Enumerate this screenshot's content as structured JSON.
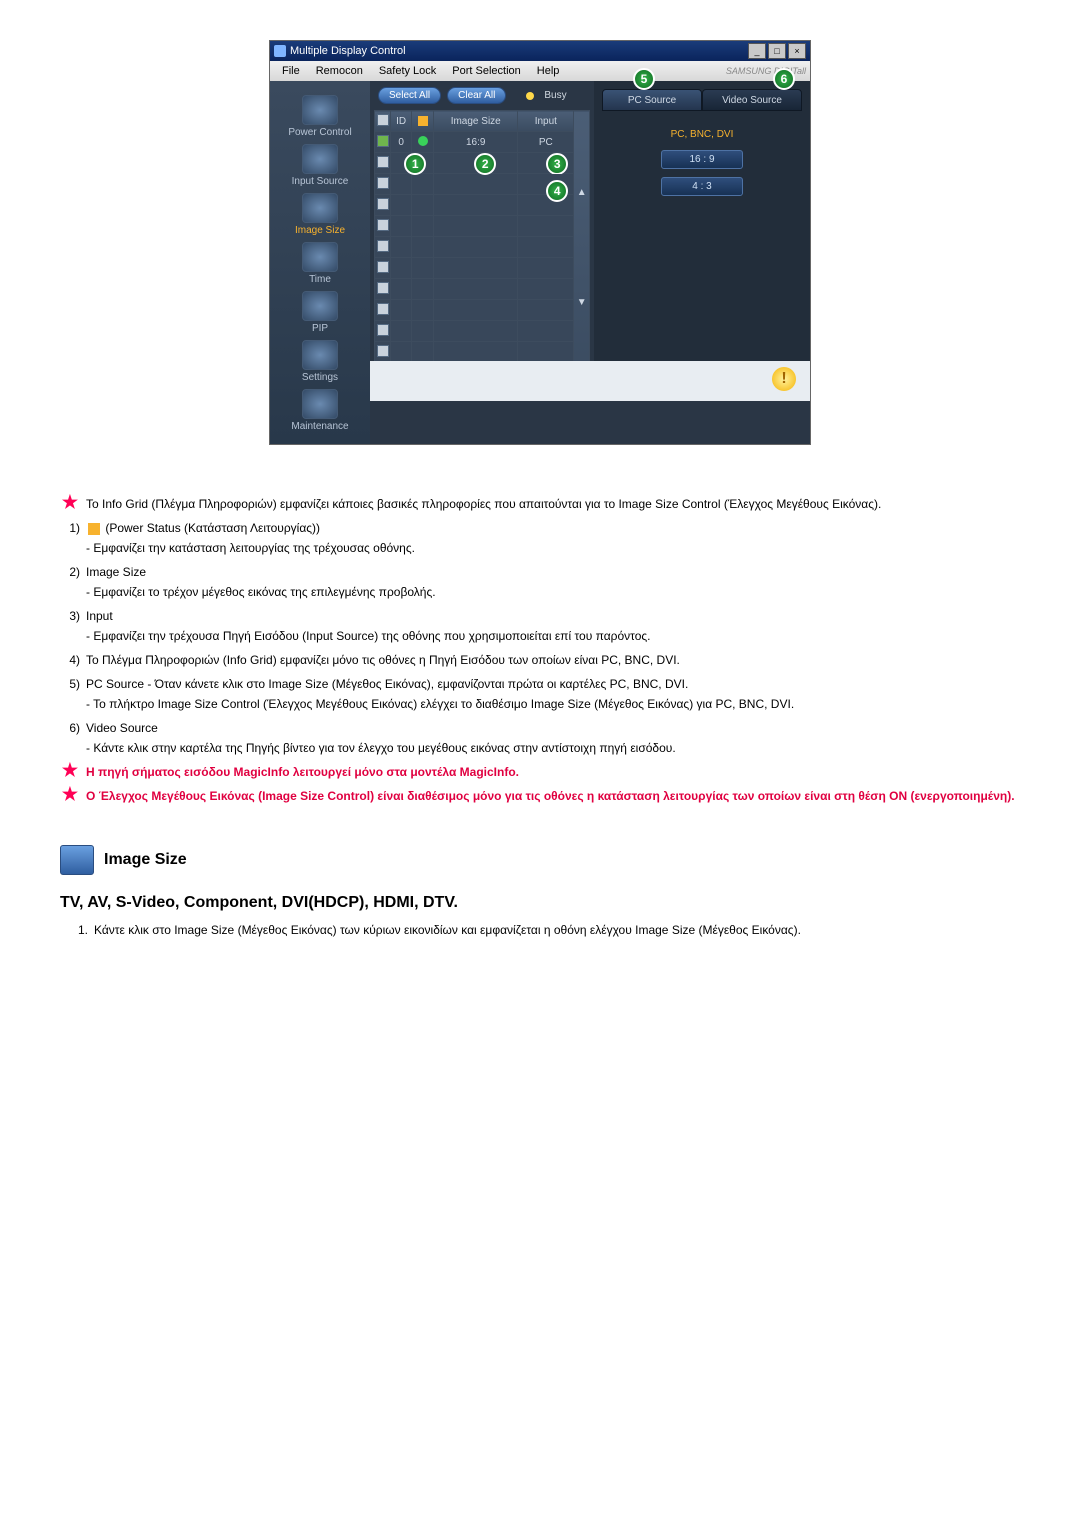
{
  "window": {
    "title": "Multiple Display Control",
    "min": "_",
    "max": "□",
    "close": "×"
  },
  "menu": {
    "file": "File",
    "remocon": "Remocon",
    "safety": "Safety Lock",
    "port": "Port Selection",
    "help": "Help",
    "brand": "SAMSUNG DIGITall"
  },
  "sidebar": {
    "power": "Power Control",
    "input": "Input Source",
    "image": "Image Size",
    "time": "Time",
    "pip": "PIP",
    "settings": "Settings",
    "maint": "Maintenance"
  },
  "grid": {
    "select_all": "Select All",
    "clear_all": "Clear All",
    "busy": "Busy",
    "col_id": "ID",
    "col_size": "Image Size",
    "col_input": "Input",
    "row1_id": "0",
    "row1_size": "16:9",
    "row1_input": "PC"
  },
  "markers": {
    "m1": "1",
    "m2": "2",
    "m3": "3",
    "m4": "4",
    "m5": "5",
    "m6": "6"
  },
  "right": {
    "tab_pc": "PC Source",
    "tab_video": "Video Source",
    "label": "PC, BNC, DVI",
    "ratio1": "16 : 9",
    "ratio2": "4 : 3"
  },
  "warn": "!",
  "doc": {
    "star1": "Το Info Grid (Πλέγμα Πληροφοριών) εμφανίζει κάποιες βασικές πληροφορίες που απαιτούνται για το Image Size Control (Έλεγχος Μεγέθους Εικόνας).",
    "l1n": "1)",
    "l1": " (Power Status (Κατάσταση Λειτουργίας))",
    "l1s": "- Εμφανίζει την κατάσταση λειτουργίας της τρέχουσας οθόνης.",
    "l2n": "2)",
    "l2": "Image Size",
    "l2s": "- Εμφανίζει το τρέχον μέγεθος εικόνας της επιλεγμένης προβολής.",
    "l3n": "3)",
    "l3": "Input",
    "l3s": "- Εμφανίζει την τρέχουσα Πηγή Εισόδου (Input Source) της οθόνης που χρησιμοποιείται επί του παρόντος.",
    "l4n": "4)",
    "l4": "Το Πλέγμα Πληροφοριών (Info Grid) εμφανίζει μόνο τις οθόνες η Πηγή Εισόδου των οποίων είναι PC, BNC, DVI.",
    "l5n": "5)",
    "l5": "PC Source - Όταν κάνετε κλικ στο Image Size (Μέγεθος Εικόνας), εμφανίζονται πρώτα οι καρτέλες PC, BNC, DVI.",
    "l5s": "- Το πλήκτρο Image Size Control (Έλεγχος Μεγέθους Εικόνας) ελέγχει το διαθέσιμο Image Size (Μέγεθος Εικόνας) για PC, BNC, DVI.",
    "l6n": "6)",
    "l6": "Video Source",
    "l6s": "- Κάντε κλικ στην καρτέλα της Πηγής βίντεο για τον έλεγχο του μεγέθους εικόνας στην αντίστοιχη πηγή εισόδου.",
    "red1": "Η πηγή σήματος εισόδου MagicInfo λειτουργεί μόνο στα μοντέλα MagicInfo.",
    "red2": "Ο Έλεγχος Μεγέθους Εικόνας (Image Size Control) είναι διαθέσιμος μόνο για τις οθόνες η κατάσταση λειτουργίας των οποίων είναι στη θέση ON (ενεργοποιημένη)."
  },
  "section": {
    "title": "Image Size",
    "sub": "TV, AV, S-Video, Component, DVI(HDCP), HDMI, DTV.",
    "n1": "1.",
    "t1": "Κάντε κλικ στο Image Size (Μέγεθος Εικόνας) των κύριων εικονιδίων και εμφανίζεται η οθόνη ελέγχου Image Size (Μέγεθος Εικόνας)."
  }
}
